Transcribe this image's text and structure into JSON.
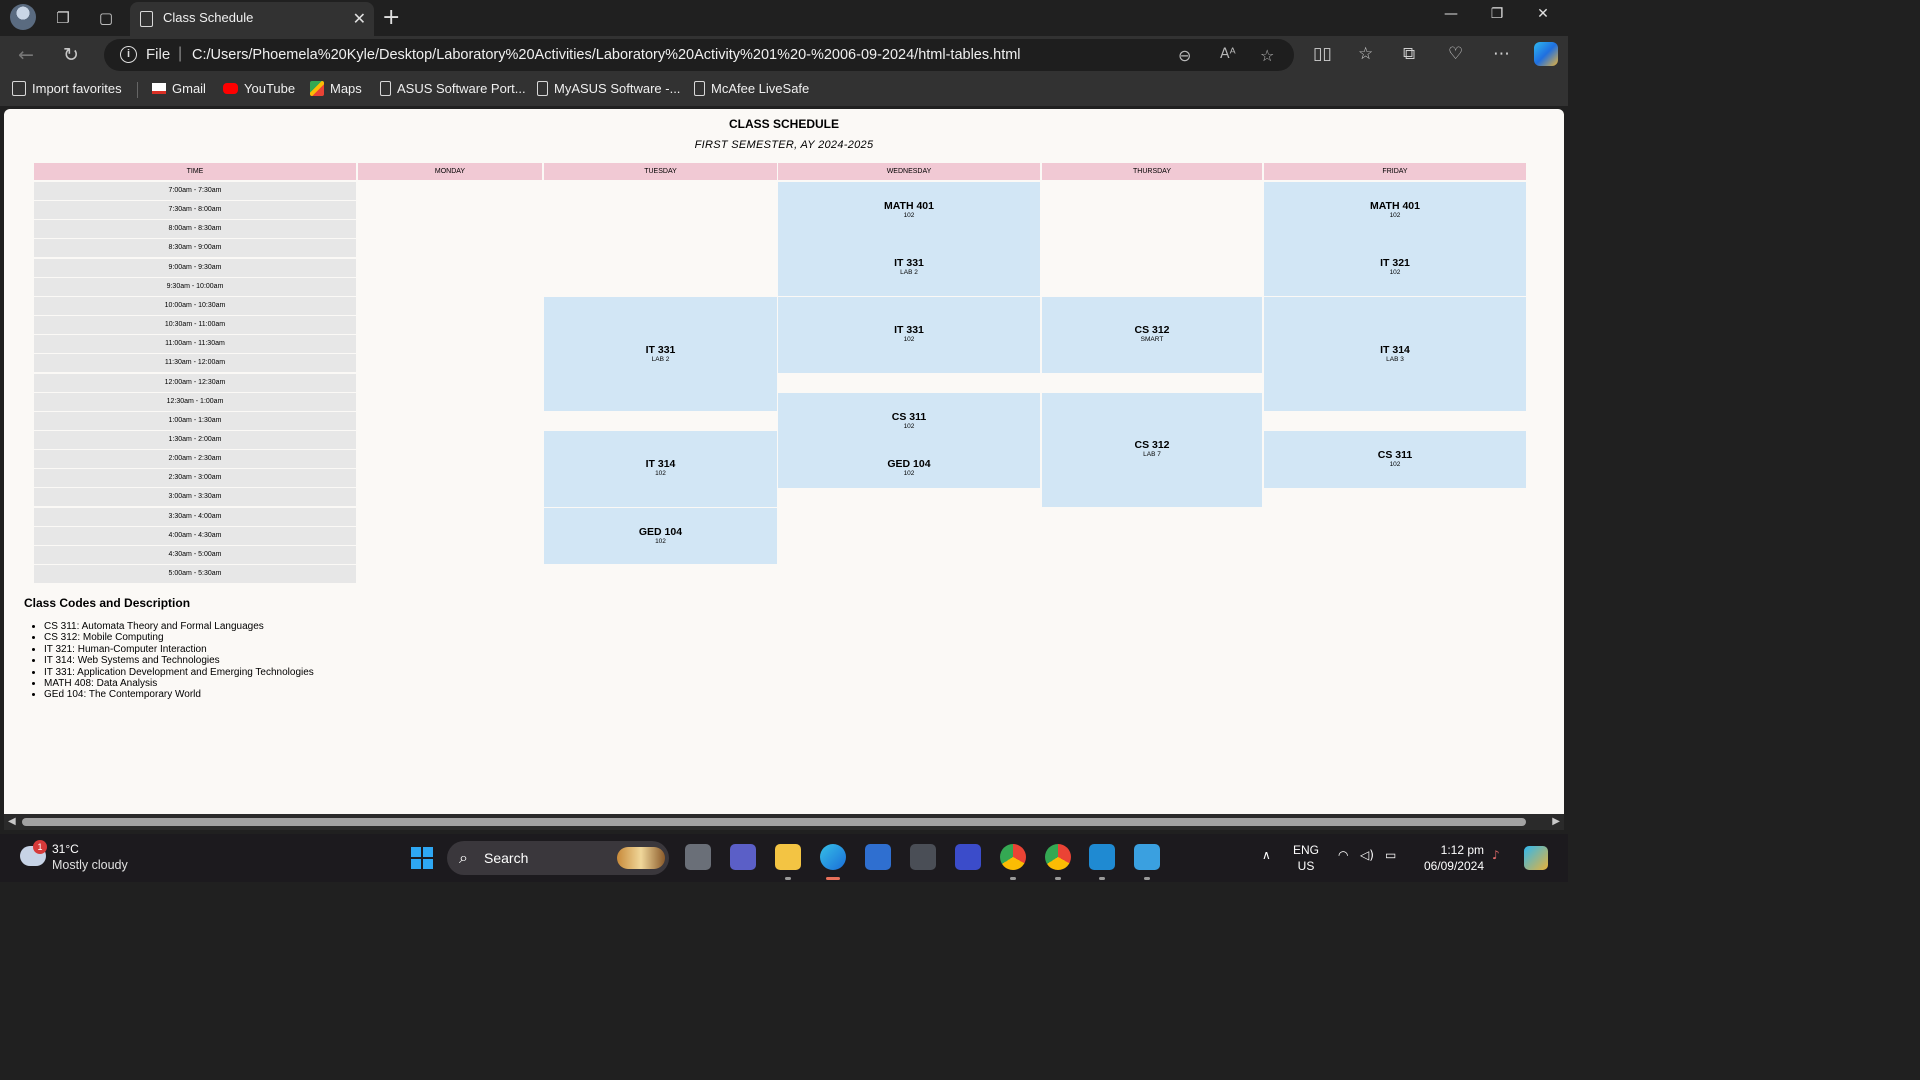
{
  "browser": {
    "tab_title": "Class Schedule",
    "address_scheme": "File",
    "url": "C:/Users/Phoemela%20Kyle/Desktop/Laboratory%20Activities/Laboratory%20Activity%201%20-%2006-09-2024/html-tables.html",
    "favorites": [
      "Import favorites",
      "Gmail",
      "YouTube",
      "Maps",
      "ASUS Software Port...",
      "MyASUS Software -...",
      "McAfee LiveSafe"
    ]
  },
  "schedule": {
    "title": "CLASS SCHEDULE",
    "subtitle": "FIRST SEMESTER, AY 2024-2025",
    "headers": [
      "TIME",
      "MONDAY",
      "TUESDAY",
      "WEDNESDAY",
      "THURSDAY",
      "FRIDAY"
    ],
    "times": [
      "7:00am - 7:30am",
      "7:30am - 8:00am",
      "8:00am - 8:30am",
      "8:30am - 9:00am",
      "9:00am - 9:30am",
      "9:30am - 10:00am",
      "10:00am - 10:30am",
      "10:30am - 11:00am",
      "11:00am - 11:30am",
      "11:30am - 12:00am",
      "12:00am - 12:30am",
      "12:30am - 1:00am",
      "1:00am - 1:30am",
      "1:30am - 2:00am",
      "2:00am - 2:30am",
      "2:30am - 3:00am",
      "3:00am - 3:30am",
      "3:30am - 4:00am",
      "4:00am - 4:30am",
      "4:30am - 5:00am",
      "5:00am - 5:30am"
    ],
    "classes": [
      {
        "day": 3,
        "start": 1,
        "span": 3,
        "code": "MATH 401",
        "room": "102"
      },
      {
        "day": 3,
        "start": 4,
        "span": 3,
        "code": "IT 331",
        "room": "LAB 2"
      },
      {
        "day": 3,
        "start": 7,
        "span": 4,
        "code": "IT 331",
        "room": "102"
      },
      {
        "day": 3,
        "start": 12,
        "span": 3,
        "code": "CS 311",
        "room": "102"
      },
      {
        "day": 3,
        "start": 15,
        "span": 2,
        "code": "GED 104",
        "room": "102"
      },
      {
        "day": 5,
        "start": 1,
        "span": 3,
        "code": "MATH 401",
        "room": "102"
      },
      {
        "day": 5,
        "start": 4,
        "span": 3,
        "code": "IT 321",
        "room": "102"
      },
      {
        "day": 5,
        "start": 7,
        "span": 6,
        "code": "IT 314",
        "room": "LAB 3"
      },
      {
        "day": 5,
        "start": 14,
        "span": 3,
        "code": "CS 311",
        "room": "102"
      },
      {
        "day": 2,
        "start": 7,
        "span": 6,
        "code": "IT 331",
        "room": "LAB 2"
      },
      {
        "day": 2,
        "start": 14,
        "span": 4,
        "code": "IT 314",
        "room": "102"
      },
      {
        "day": 2,
        "start": 18,
        "span": 3,
        "code": "GED 104",
        "room": "102"
      },
      {
        "day": 4,
        "start": 7,
        "span": 4,
        "code": "CS 312",
        "room": "SMART"
      },
      {
        "day": 4,
        "start": 12,
        "span": 6,
        "code": "CS 312",
        "room": "LAB 7"
      }
    ]
  },
  "codes": {
    "title": "Class Codes and Description",
    "items": [
      "CS 311: Automata Theory and Formal Languages",
      "CS 312: Mobile Computing",
      "IT 321: Human-Computer Interaction",
      "IT 314: Web Systems and Technologies",
      "IT 331: Application Development and Emerging Technologies",
      "MATH 408: Data Analysis",
      "GEd 104: The Contemporary World"
    ]
  },
  "taskbar": {
    "weather_temp": "31°C",
    "weather_desc": "Mostly cloudy",
    "weather_badge": "1",
    "search_label": "Search",
    "lang_line1": "ENG",
    "lang_line2": "US",
    "time": "1:12 pm",
    "date": "06/09/2024"
  }
}
